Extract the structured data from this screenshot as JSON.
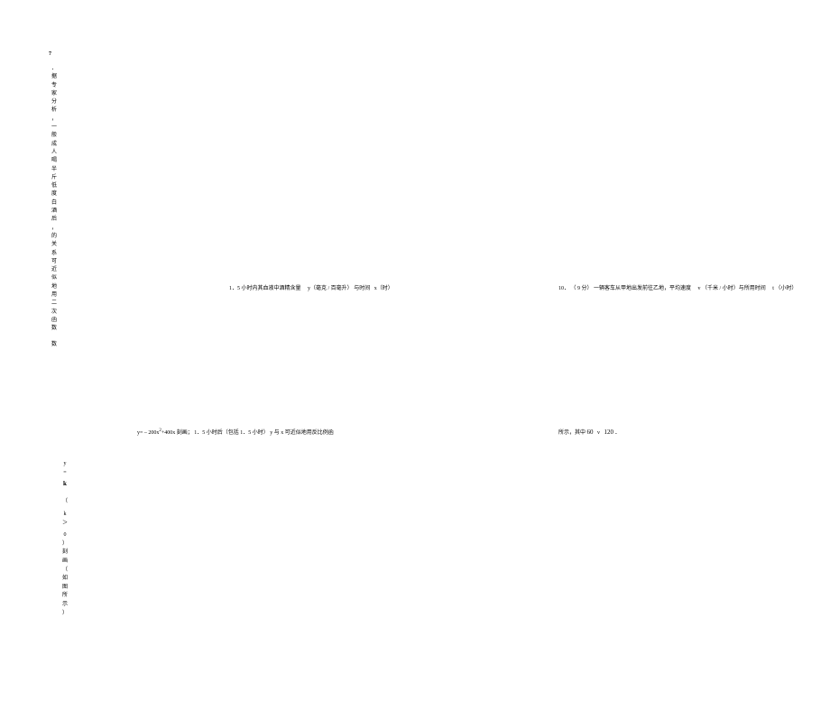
{
  "q7": {
    "number": "7",
    "dot": "．",
    "vert_part1": "据专家分析",
    "comma1": "，",
    "vert_part2": "一般成人喝半斤低度白酒后",
    "comma2": "，",
    "vert_part3": "的关系可近似地用二次函数",
    "vert_part4": "数"
  },
  "line1": {
    "prefix": "1．5 小时内其血液中酒精含量",
    "y": "y（毫克 / 百毫升）",
    "mid": "与时间",
    "x": "x（时）"
  },
  "q10": {
    "number": "10．",
    "points": "（ 9 分）",
    "text1": "一辆客车从甲地出发前往乙地，平均速度",
    "v": "v",
    "v_unit": "（千米 / 小时）与所用时间",
    "t": "t",
    "t_unit": "（小时）"
  },
  "line2_left": {
    "formula_prefix": "y= – 200x",
    "exp": "2",
    "formula_suffix": "+400x",
    "text": "刻画； 1．5 小时后（包括 1．5 小时） y 与 x 可近似地用反比例函"
  },
  "line2_right": {
    "prefix": "所示，其中",
    "n60": "60",
    "v": "v",
    "n120": "120",
    "dot": "．"
  },
  "vert2": {
    "y_eq": "y",
    "eq": "=",
    "k": "k",
    "paren_open": "（",
    "k2": "k",
    "gt": "＞",
    "zero": "0",
    "paren_close": "）",
    "text": "刻画（如图所示）"
  }
}
